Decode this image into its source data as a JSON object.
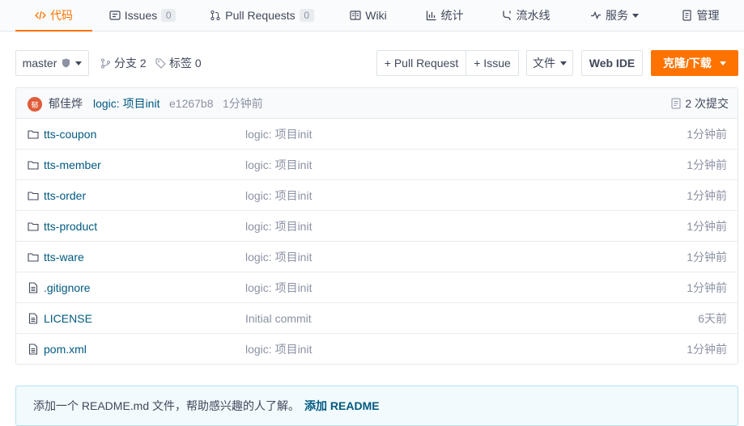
{
  "tabs": [
    {
      "label": "代码",
      "icon": "code-icon"
    },
    {
      "label": "Issues",
      "icon": "issues-icon",
      "count": "0"
    },
    {
      "label": "Pull Requests",
      "icon": "pull-request-icon",
      "count": "0"
    },
    {
      "label": "Wiki",
      "icon": "wiki-icon"
    },
    {
      "label": "统计",
      "icon": "chart-icon"
    },
    {
      "label": "流水线",
      "icon": "pipeline-icon"
    },
    {
      "label": "服务",
      "icon": "pulse-icon"
    },
    {
      "label": "管理",
      "icon": "manage-icon"
    }
  ],
  "branch": {
    "current": "master",
    "branches_label": "分支 2",
    "tags_label": "标签 0"
  },
  "actions": {
    "pull_request": "+ Pull Request",
    "issue": "+ Issue",
    "file_menu": "文件",
    "web_ide": "Web IDE",
    "clone": "克隆/下载"
  },
  "commit": {
    "avatar_char": "郁",
    "author": "郁佳烨",
    "message": "logic: 项目init",
    "hash": "e1267b8",
    "time": "1分钟前",
    "count_label": "2 次提交"
  },
  "files": [
    {
      "name": "tts-coupon",
      "type": "folder",
      "message": "logic: 项目init",
      "time": "1分钟前"
    },
    {
      "name": "tts-member",
      "type": "folder",
      "message": "logic: 项目init",
      "time": "1分钟前"
    },
    {
      "name": "tts-order",
      "type": "folder",
      "message": "logic: 项目init",
      "time": "1分钟前"
    },
    {
      "name": "tts-product",
      "type": "folder",
      "message": "logic: 项目init",
      "time": "1分钟前"
    },
    {
      "name": "tts-ware",
      "type": "folder",
      "message": "logic: 项目init",
      "time": "1分钟前"
    },
    {
      "name": ".gitignore",
      "type": "file",
      "message": "logic: 项目init",
      "time": "1分钟前"
    },
    {
      "name": "LICENSE",
      "type": "file",
      "message": "Initial commit",
      "time": "6天前"
    },
    {
      "name": "pom.xml",
      "type": "file",
      "message": "logic: 项目init",
      "time": "1分钟前"
    }
  ],
  "readme": {
    "text": "添加一个 README.md 文件，帮助感兴趣的人了解。",
    "link": "添加 README"
  },
  "colors": {
    "accent": "#fe7300",
    "link": "#005980",
    "muted": "#8c92a4"
  }
}
